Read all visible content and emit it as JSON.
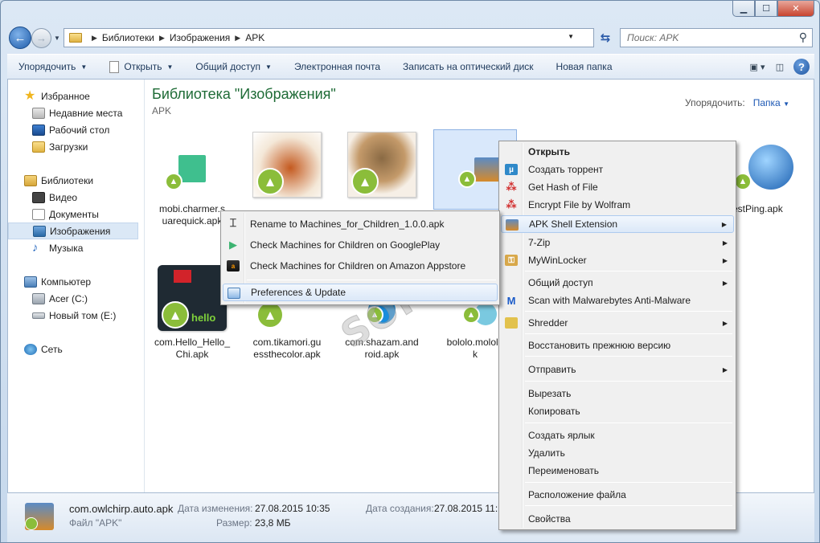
{
  "address": {
    "crumbs": [
      "Библиотеки",
      "Изображения",
      "APK"
    ]
  },
  "search": {
    "placeholder": "Поиск: APK"
  },
  "toolbar": {
    "organize": "Упорядочить",
    "open": "Открыть",
    "share": "Общий доступ",
    "email": "Электронная почта",
    "burn": "Записать на оптический диск",
    "new_folder": "Новая папка"
  },
  "nav": {
    "favorites": "Избранное",
    "recent": "Недавние места",
    "desktop": "Рабочий стол",
    "downloads": "Загрузки",
    "libraries": "Библиотеки",
    "video": "Видео",
    "documents": "Документы",
    "images": "Изображения",
    "music": "Музыка",
    "computer": "Компьютер",
    "drive_c": "Acer (C:)",
    "drive_e": "Новый том (E:)",
    "network": "Сеть"
  },
  "content": {
    "title": "Библиотека \"Изображения\"",
    "subtitle": "APK",
    "sort_label": "Упорядочить:",
    "sort_value": "Папка"
  },
  "files": [
    {
      "name": "mobi.charmer.squarequick.apk",
      "l1": "mobi.charmer.s",
      "l2": "uarequick.apk"
    },
    {
      "name": "",
      "l1": "",
      "l2": ""
    },
    {
      "name": "",
      "l1": "",
      "l2": ""
    },
    {
      "name": "",
      "l1": "",
      "l2": ""
    },
    {
      "name": "estPing.apk",
      "l1": "estPing.apk",
      "l2": ""
    },
    {
      "name": "com.Hello_Hello_Chi.apk",
      "l1": "com.Hello_Hello_",
      "l2": "Chi.apk"
    },
    {
      "name": "com.tikamori.guessthecolor.apk",
      "l1": "com.tikamori.gu",
      "l2": "essthecolor.apk"
    },
    {
      "name": "com.shazam.android.apk",
      "l1": "com.shazam.and",
      "l2": "roid.apk"
    },
    {
      "name": "bololo.mololo.apk",
      "l1": "bololo.mololo",
      "l2": "k"
    }
  ],
  "hello_text": "hello",
  "details": {
    "filename": "com.owlchirp.auto.apk",
    "filetype": "Файл \"APK\"",
    "modified_label": "Дата изменения:",
    "modified_value": "27.08.2015 10:35",
    "created_label": "Дата создания:",
    "created_value": "27.08.2015 11:1",
    "size_label": "Размер:",
    "size_value": "23,8 МБ"
  },
  "context_menu": {
    "open": "Открыть",
    "torrent": "Создать  торрент",
    "hash": "Get Hash of File",
    "encrypt": "Encrypt File by Wolfram",
    "apk_shell": "APK Shell Extension",
    "zip": "7-Zip",
    "winlocker": "MyWinLocker",
    "share": "Общий доступ",
    "malwarebytes": "Scan with Malwarebytes Anti-Malware",
    "shredder": "Shredder",
    "restore": "Восстановить прежнюю версию",
    "send_to": "Отправить",
    "cut": "Вырезать",
    "copy": "Копировать",
    "shortcut": "Создать ярлык",
    "delete": "Удалить",
    "rename": "Переименовать",
    "location": "Расположение файла",
    "properties": "Свойства"
  },
  "submenu": {
    "rename_to": "Rename to Machines_for_Children_1.0.0.apk",
    "googleplay": "Check Machines for Children on GooglePlay",
    "amazon": "Check Machines for Children on Amazon Appstore",
    "prefs": "Preferences & Update"
  },
  "watermark": "SOFTPORTAL",
  "colors": {
    "title_green": "#1e6b36",
    "android_green": "#8bbd3a",
    "highlight": "#dbe8f8"
  }
}
